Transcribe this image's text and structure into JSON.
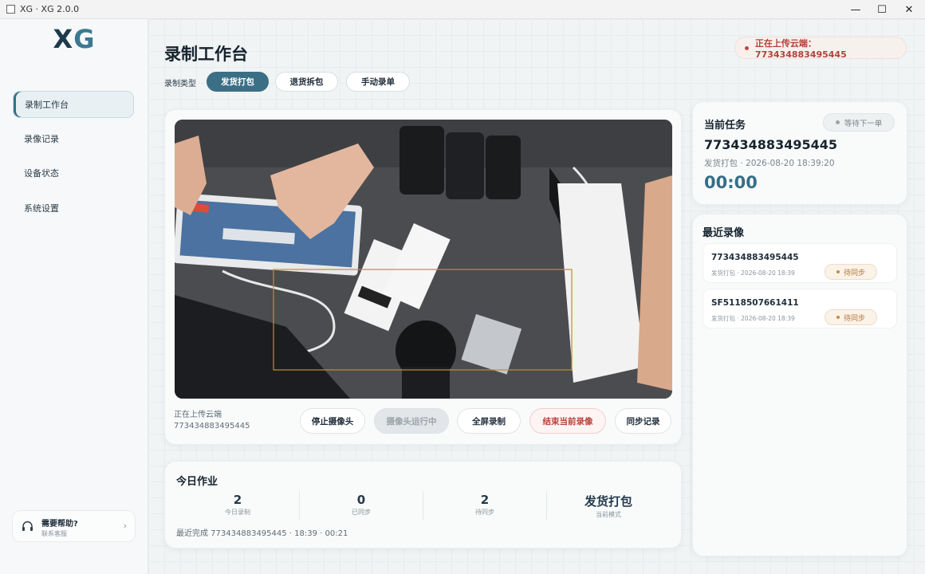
{
  "window": {
    "title": "XG · XG 2.0.0"
  },
  "logo": {
    "x": "X",
    "g": "G"
  },
  "sidebar": {
    "items": [
      {
        "label": "录制工作台",
        "active": true
      },
      {
        "label": "录像记录"
      },
      {
        "label": "设备状态"
      },
      {
        "label": "系统设置"
      }
    ],
    "help": {
      "title": "需要帮助?",
      "subtitle": "联系客服"
    }
  },
  "header": {
    "title": "录制工作台",
    "record_type_label": "录制类型",
    "tabs": [
      "发货打包",
      "退货拆包",
      "手动录单"
    ],
    "upload_status": "正在上传云端：773434883495445"
  },
  "camera": {
    "status_line1": "正在上传云端",
    "status_line2": "773434883495445",
    "buttons": [
      "停止摄像头",
      "摄像头运行中",
      "全屏录制",
      "结束当前录像",
      "同步记录"
    ]
  },
  "today": {
    "title": "今日作业",
    "stats": [
      {
        "value": "2",
        "label": "今日录制"
      },
      {
        "value": "0",
        "label": "已同步"
      },
      {
        "value": "2",
        "label": "待同步"
      },
      {
        "value": "发货打包",
        "label": "当前模式"
      }
    ],
    "last_done": "最近完成  773434883495445 · 18:39 · 00:21"
  },
  "task": {
    "title": "当前任务",
    "status": "等待下一单",
    "order_id": "773434883495445",
    "meta": "发货打包 · 2026-08-20 18:39:20",
    "timer": "00:00"
  },
  "recent": {
    "title": "最近录像",
    "items": [
      {
        "id": "773434883495445",
        "meta": "发货打包 · 2026-08-20 18:39",
        "status": "待同步"
      },
      {
        "id": "SF5118507661411",
        "meta": "发货打包 · 2026-08-20 18:39",
        "status": "待同步"
      }
    ]
  },
  "colors": {
    "accent": "#3b6f85",
    "danger": "#b8443d",
    "pending": "#b07a3e"
  }
}
